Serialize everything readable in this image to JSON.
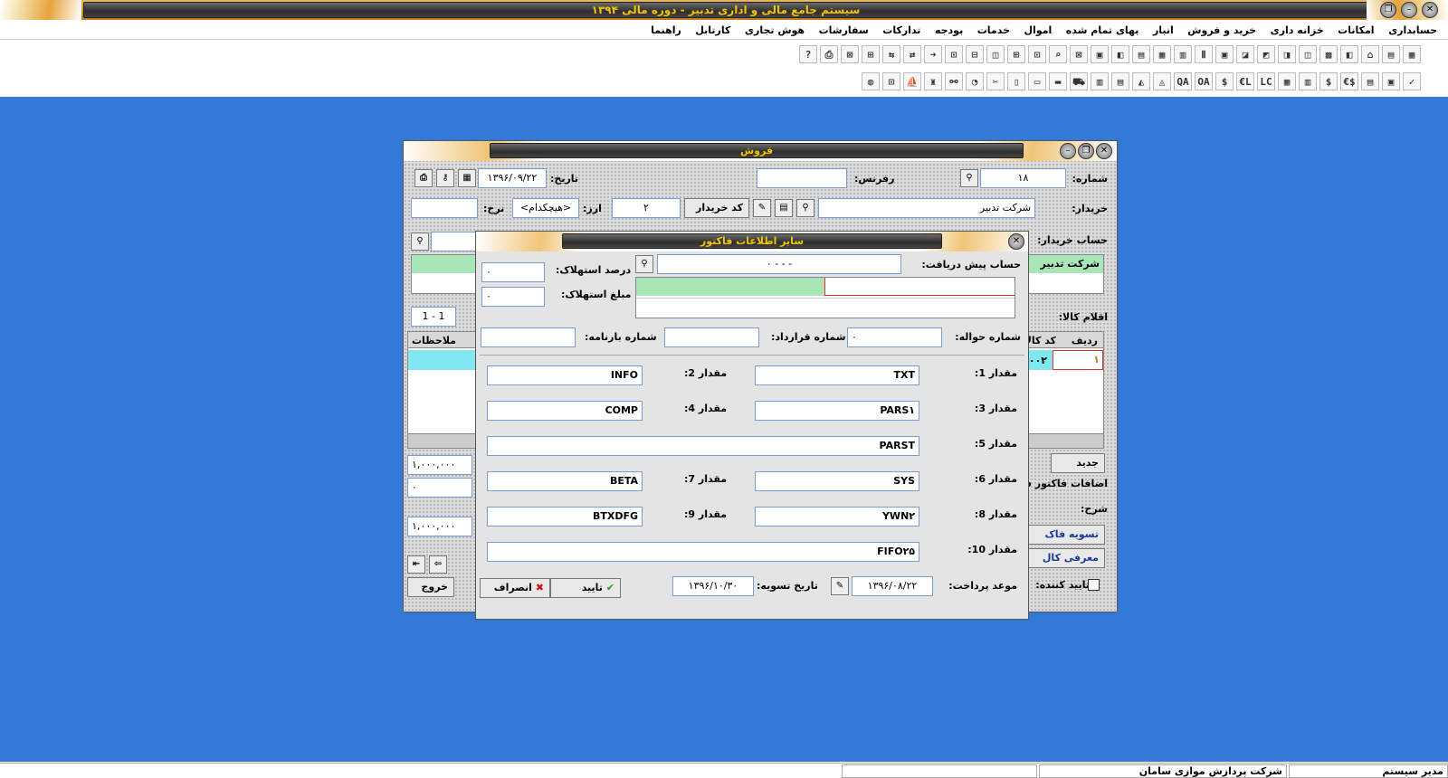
{
  "app_title": "سیستم جامع مالی و اداری تدبیر - دوره مالی ۱۳۹۴",
  "menu": [
    "حسابداری",
    "امکانات",
    "خزانه داری",
    "خرید و فروش",
    "انبار",
    "بهای تمام شده",
    "اموال",
    "خدمات",
    "بودجه",
    "تدارکات",
    "سفارشات",
    "هوش تجاری",
    "کارتابل",
    "راهنما"
  ],
  "toolbar1": [
    "▦",
    "▤",
    "⌂",
    "◧",
    "▩",
    "◫",
    "◨",
    "◩",
    "◪",
    "▣",
    "Ⅱ",
    "▥",
    "▦",
    "▤",
    "◧",
    "▣",
    "⊠",
    "⌕",
    "⊡",
    "⊞",
    "◫",
    "⊟",
    "⊡",
    "➜",
    "⇄",
    "⇆",
    "⊞",
    "⊠",
    "⎙",
    "?"
  ],
  "toolbar2": [
    "✓",
    "▣",
    "▤",
    "$€",
    "$",
    "▥",
    "▦",
    "LC",
    "L€",
    "$",
    "OA",
    "QA",
    "◬",
    "◭",
    "▤",
    "▥",
    "⛟",
    "▬",
    "▭",
    "▯",
    "✂",
    "◔",
    "⚯",
    "♜",
    "⛵",
    "⊡",
    "◍"
  ],
  "sales": {
    "title": "فروش",
    "number_label": "شماره:",
    "number_value": "۱۸",
    "ref_label": "رفرنس:",
    "ref_value": "",
    "date_label": "تاریخ:",
    "date_value": "۱۳۹۶/۰۹/۲۲",
    "buyer_label": "خریدار:",
    "buyer_value": "شرکت تدبیر",
    "buyer_code_button": "کد خریدار",
    "currency_label": "ارز:",
    "currency_value": "۲",
    "rate_label": "نرخ:",
    "rate_select": "<هیچکدام>",
    "rate_value": "",
    "buyer_account_label": "حساب خریدار:",
    "account_list_item": "شرکت تدبیر",
    "items_label": "اقلام کالا:",
    "pager": "1 - 1",
    "grid_headers": [
      "ردیف",
      "کد کالا",
      "ملاحظات"
    ],
    "grid_row": [
      "۱",
      "۰۱۰۰۰۲"
    ],
    "new_button": "جدید",
    "additions_label": "اضافات فاکتور فرو",
    "desc_label": "شرح:",
    "settle_button": "تسویه فاک",
    "intro_button": "معرفی کال",
    "approver_label": "تایید کننده:",
    "exit_button": "خروج",
    "total1": "۱,۰۰۰,۰۰۰",
    "total2": "۰",
    "total3": "۱,۰۰۰,۰۰۰"
  },
  "dialog": {
    "title": "سایر اطلاعات فاکتور",
    "prepay_label": "حساب پیش دریافت:",
    "prepay_value": "- - - ۰",
    "dep_pct_label": "درصد استهلاک:",
    "dep_pct_value": "۰",
    "dep_amt_label": "مبلغ استهلاک:",
    "dep_amt_value": "۰",
    "transfer_label": "شماره حواله:",
    "transfer_value": "۰",
    "contract_label": "شماره قرارداد:",
    "contract_value": "",
    "bill_label": "شماره بارنامه:",
    "bill_value": "",
    "v1_label": "مقدار 1:",
    "v1": "TXT",
    "v2_label": "مقدار 2:",
    "v2": "INFO",
    "v3_label": "مقدار 3:",
    "v3": "PARS۱",
    "v4_label": "مقدار 4:",
    "v4": "COMP",
    "v5_label": "مقدار 5:",
    "v5": "PARST",
    "v6_label": "مقدار 6:",
    "v6": "SYS",
    "v7_label": "مقدار 7:",
    "v7": "BETA",
    "v8_label": "مقدار 8:",
    "v8": "YWN۲",
    "v9_label": "مقدار 9:",
    "v9": "BTXDFG",
    "v10_label": "مقدار 10:",
    "v10": "FIFO۲۵",
    "due_label": "موعد پرداخت:",
    "due_value": "۱۳۹۶/۰۸/۲۲",
    "settle_label": "تاریخ تسویه:",
    "settle_value": "۱۳۹۶/۱۰/۳۰",
    "ok_button": "تایید",
    "cancel_button": "انصراف"
  },
  "status": {
    "user": "مدیر سیستم",
    "company": "شرکت پردازش موازی سامان"
  }
}
